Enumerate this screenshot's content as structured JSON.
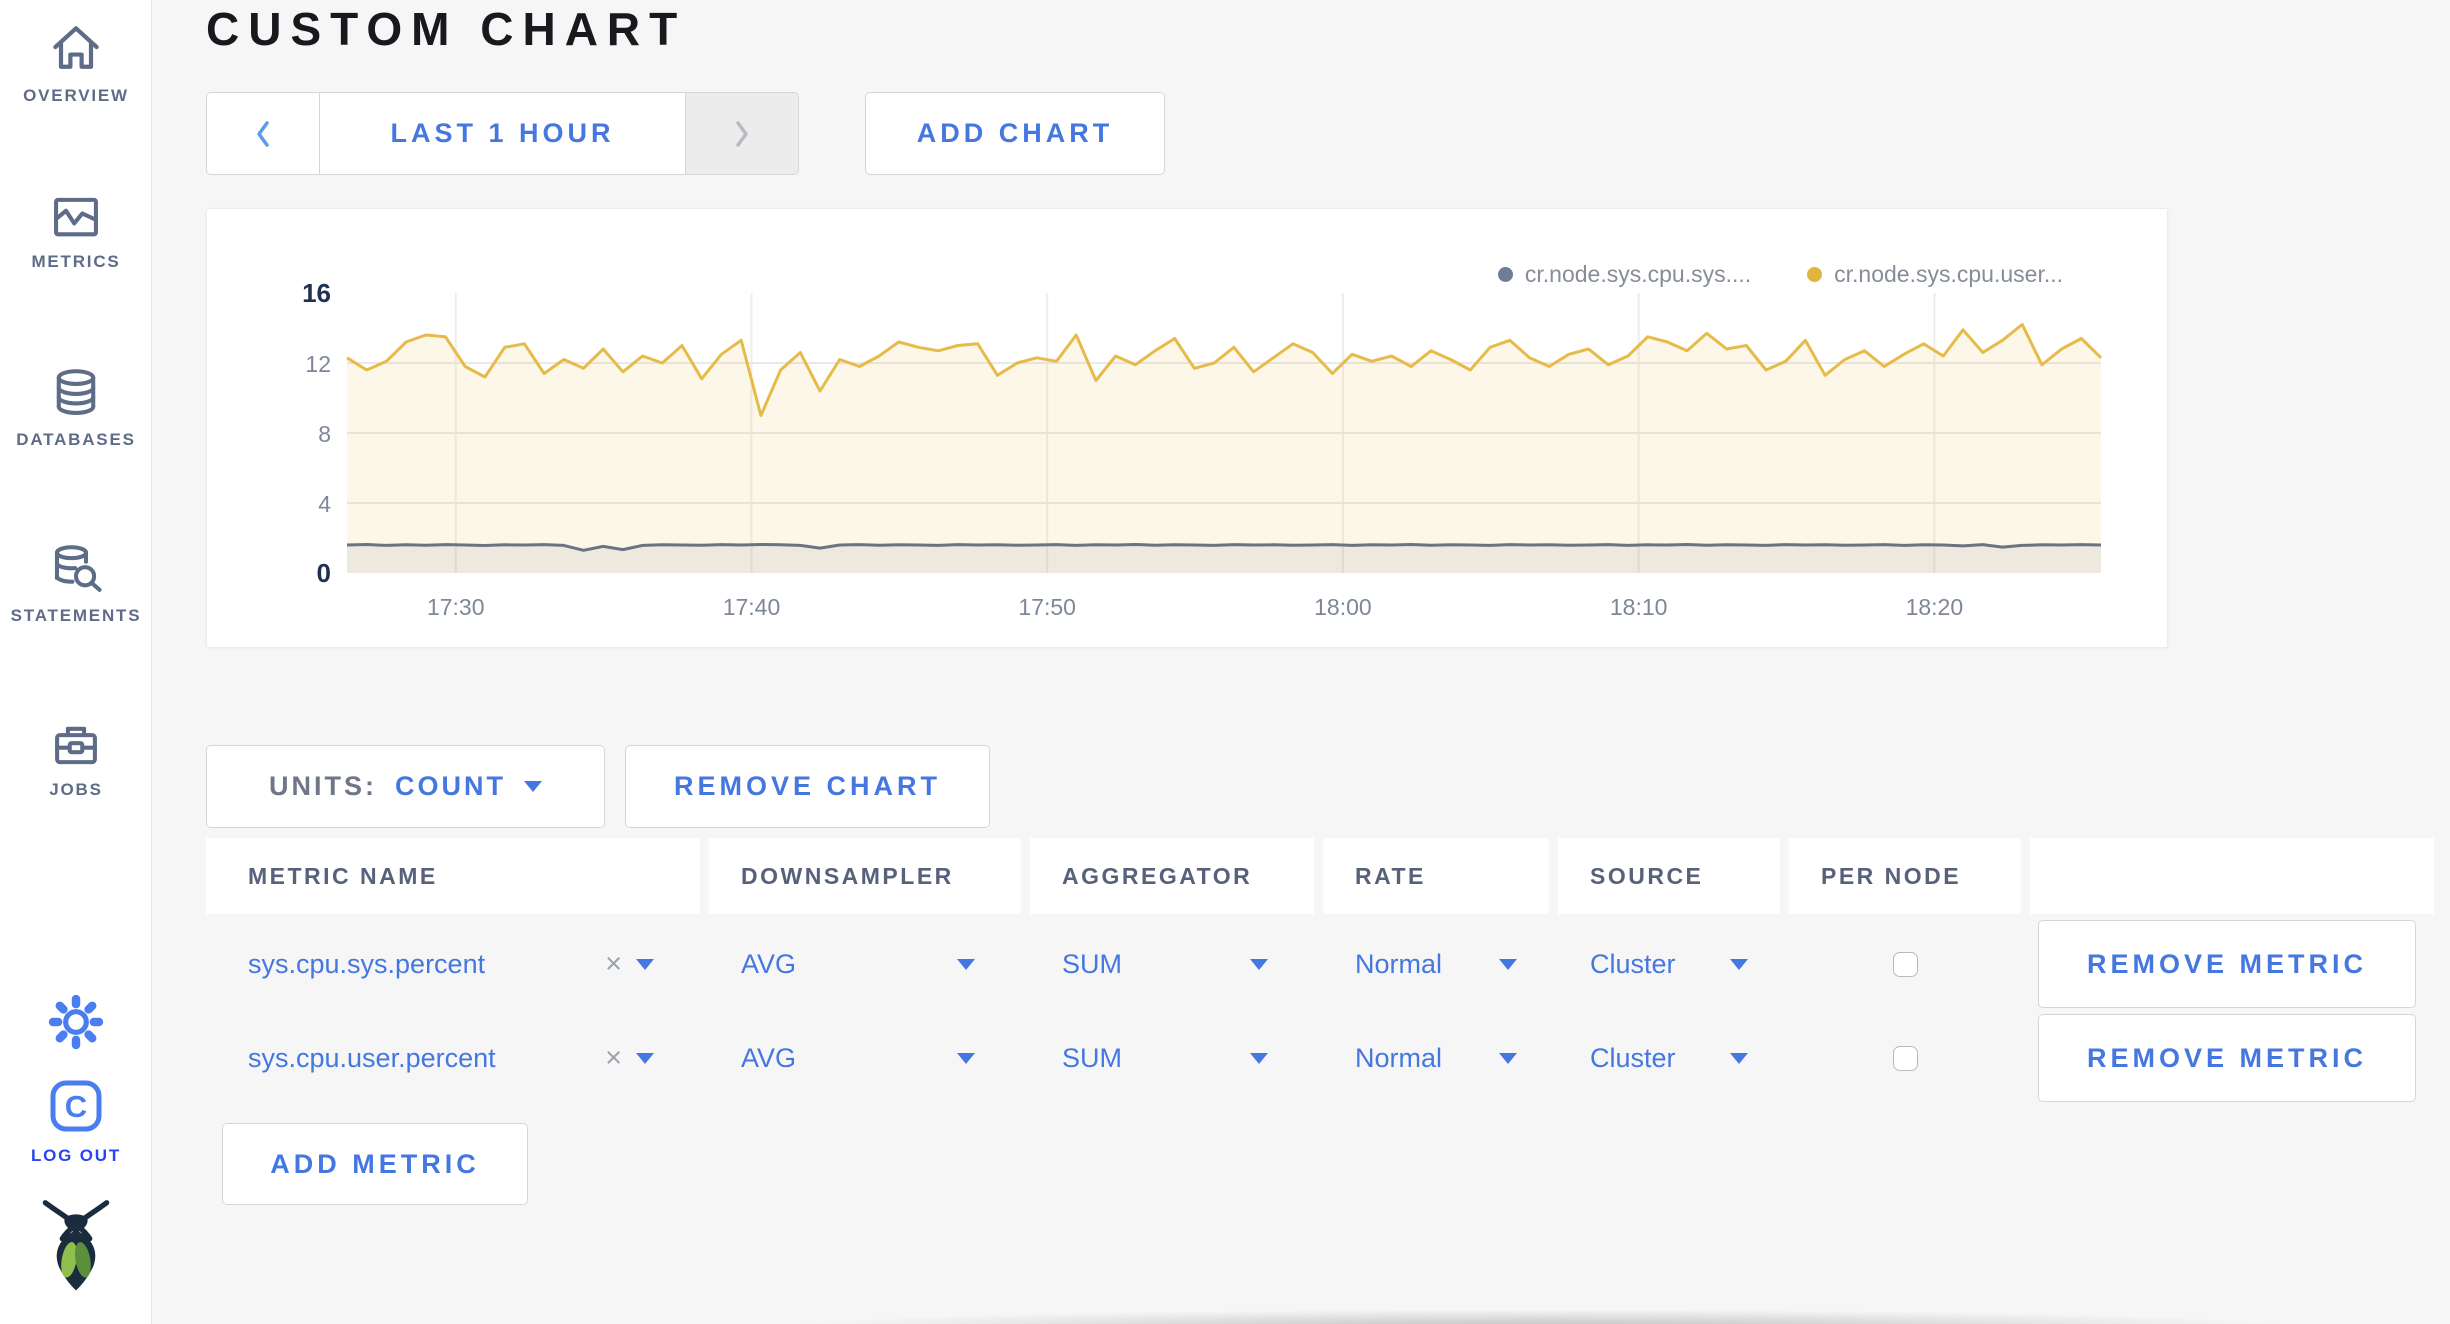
{
  "sidebar": {
    "items": [
      {
        "label": "OVERVIEW"
      },
      {
        "label": "METRICS"
      },
      {
        "label": "DATABASES"
      },
      {
        "label": "STATEMENTS"
      },
      {
        "label": "JOBS"
      }
    ],
    "logout_label": "LOG OUT"
  },
  "header": {
    "title": "CUSTOM CHART"
  },
  "controls": {
    "time_range_label": "LAST 1 HOUR",
    "add_chart_label": "ADD CHART"
  },
  "chart_controls": {
    "units_label": "UNITS:",
    "units_value": "COUNT",
    "remove_chart_label": "REMOVE CHART"
  },
  "chart_data": {
    "type": "area",
    "title": "",
    "xlabel": "",
    "ylabel": "",
    "ylim": [
      0,
      16
    ],
    "y_ticks": [
      0,
      4,
      8,
      12,
      16
    ],
    "x_ticks": [
      "17:30",
      "17:40",
      "17:50",
      "18:00",
      "18:10",
      "18:20"
    ],
    "x_tick_fracs": [
      0.062,
      0.2306,
      0.3992,
      0.5678,
      0.7364,
      0.905
    ],
    "grid": true,
    "legend_position": "top-right",
    "legend": [
      {
        "name": "cr.node.sys.cpu.sys....",
        "color": "#6f7d96"
      },
      {
        "name": "cr.node.sys.cpu.user...",
        "color": "#e0b53e"
      }
    ],
    "series": [
      {
        "name": "cr.node.sys.cpu.sys....",
        "color": "#6a7382",
        "fill": "rgba(106,115,130,0.10)",
        "values": [
          1.6,
          1.63,
          1.58,
          1.61,
          1.59,
          1.62,
          1.6,
          1.57,
          1.61,
          1.6,
          1.62,
          1.58,
          1.3,
          1.52,
          1.34,
          1.58,
          1.61,
          1.6,
          1.59,
          1.62,
          1.6,
          1.63,
          1.61,
          1.58,
          1.42,
          1.6,
          1.62,
          1.59,
          1.61,
          1.6,
          1.58,
          1.62,
          1.6,
          1.61,
          1.59,
          1.6,
          1.62,
          1.58,
          1.61,
          1.6,
          1.63,
          1.59,
          1.61,
          1.6,
          1.58,
          1.62,
          1.6,
          1.61,
          1.59,
          1.6,
          1.62,
          1.58,
          1.61,
          1.6,
          1.63,
          1.59,
          1.61,
          1.6,
          1.58,
          1.62,
          1.6,
          1.61,
          1.59,
          1.6,
          1.62,
          1.58,
          1.61,
          1.6,
          1.63,
          1.59,
          1.61,
          1.6,
          1.58,
          1.62,
          1.6,
          1.61,
          1.59,
          1.6,
          1.62,
          1.58,
          1.61,
          1.6,
          1.55,
          1.62,
          1.48,
          1.58,
          1.61,
          1.6,
          1.62,
          1.6
        ]
      },
      {
        "name": "cr.node.sys.cpu.user...",
        "color": "#e6bb4a",
        "fill": "rgba(230,187,74,0.12)",
        "values": [
          12.3,
          11.6,
          12.1,
          13.2,
          13.6,
          13.5,
          11.8,
          11.2,
          12.9,
          13.1,
          11.4,
          12.2,
          11.7,
          12.8,
          11.5,
          12.4,
          12.0,
          13.0,
          11.1,
          12.5,
          13.3,
          9.0,
          11.6,
          12.6,
          10.4,
          12.2,
          11.8,
          12.4,
          13.2,
          12.9,
          12.7,
          13.0,
          13.1,
          11.3,
          12.0,
          12.3,
          12.1,
          13.6,
          11.0,
          12.4,
          11.9,
          12.7,
          13.4,
          11.7,
          12.0,
          12.9,
          11.5,
          12.3,
          13.1,
          12.6,
          11.4,
          12.5,
          12.1,
          12.4,
          11.8,
          12.7,
          12.2,
          11.6,
          12.9,
          13.3,
          12.3,
          11.8,
          12.5,
          12.8,
          11.9,
          12.4,
          13.5,
          13.2,
          12.7,
          13.7,
          12.8,
          13.0,
          11.6,
          12.1,
          13.3,
          11.3,
          12.2,
          12.7,
          11.8,
          12.5,
          13.1,
          12.4,
          13.9,
          12.6,
          13.3,
          14.2,
          11.9,
          12.8,
          13.4,
          12.3
        ]
      }
    ]
  },
  "table": {
    "headers": [
      "METRIC NAME",
      "DOWNSAMPLER",
      "AGGREGATOR",
      "RATE",
      "SOURCE",
      "PER NODE",
      ""
    ],
    "clear_glyph": "×",
    "rows": [
      {
        "metric": "sys.cpu.sys.percent",
        "downsampler": "AVG",
        "aggregator": "SUM",
        "rate": "Normal",
        "source": "Cluster",
        "per_node_checked": false,
        "action_label": "REMOVE METRIC"
      },
      {
        "metric": "sys.cpu.user.percent",
        "downsampler": "AVG",
        "aggregator": "SUM",
        "rate": "Normal",
        "source": "Cluster",
        "per_node_checked": false,
        "action_label": "REMOVE METRIC"
      }
    ],
    "add_metric_label": "ADD METRIC"
  }
}
